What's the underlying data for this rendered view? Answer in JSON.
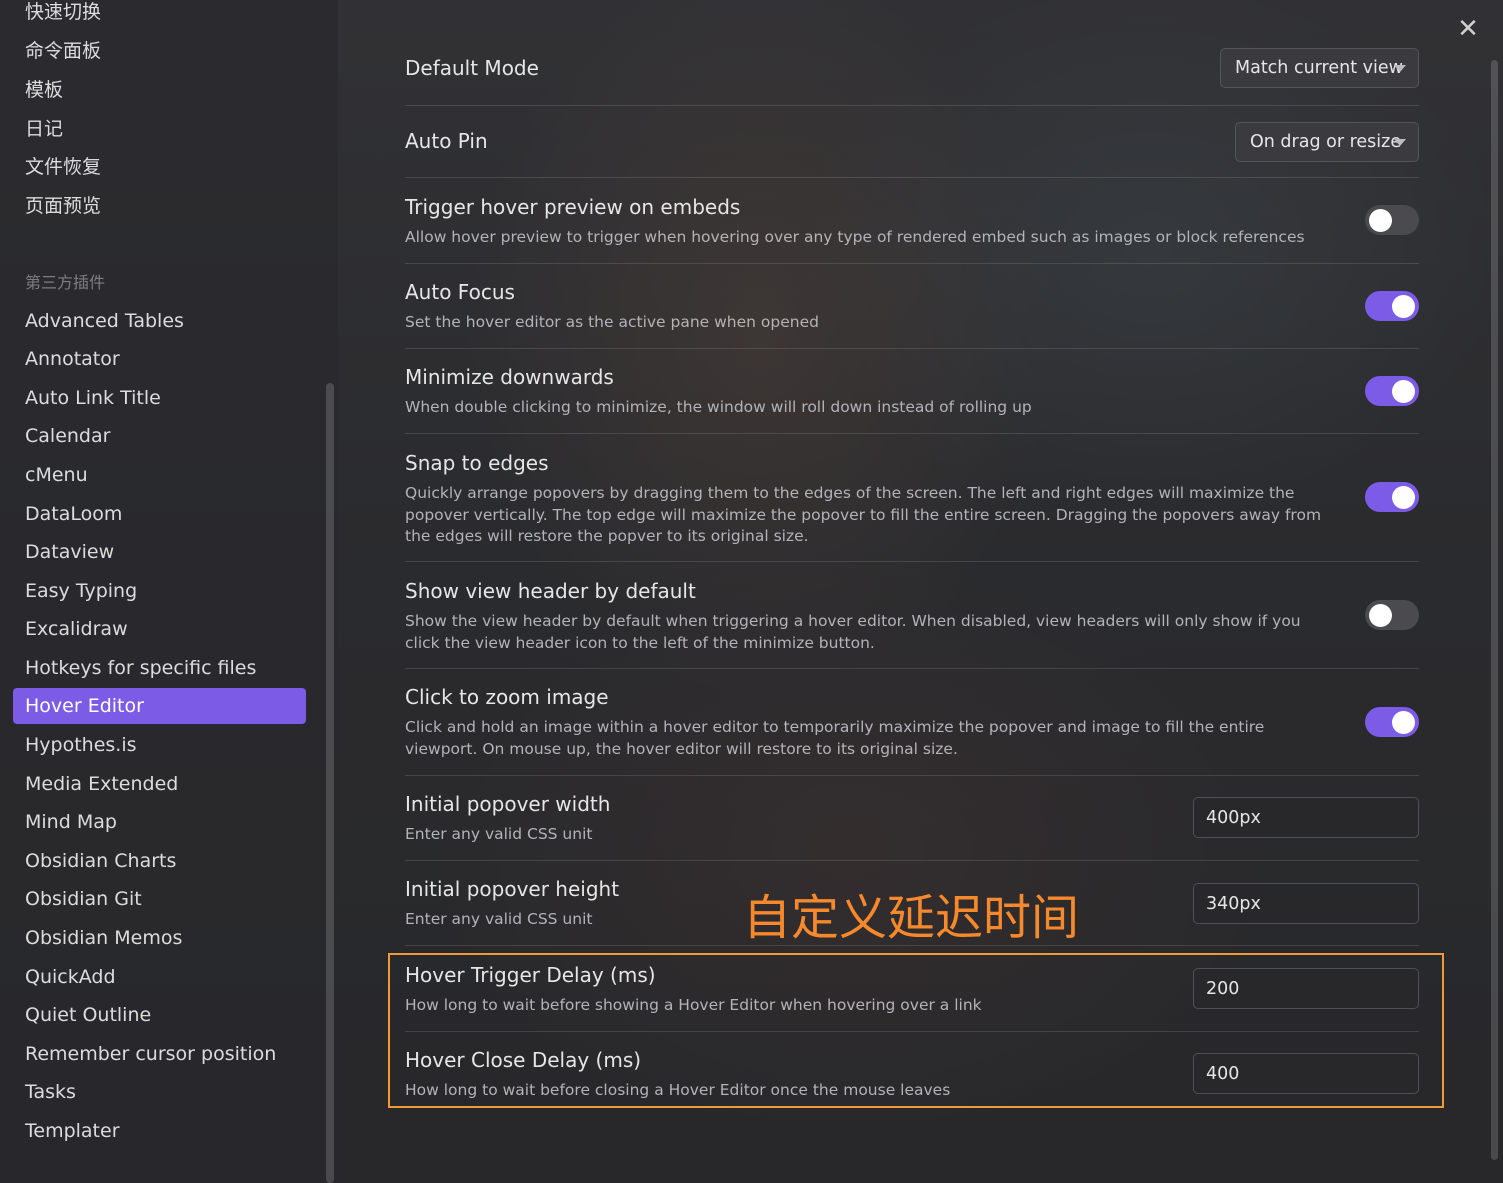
{
  "sidebar": {
    "core_items": [
      "快速切换",
      "命令面板",
      "模板",
      "日记",
      "文件恢复",
      "页面预览"
    ],
    "group_title": "第三方插件",
    "plugin_items": [
      "Advanced Tables",
      "Annotator",
      "Auto Link Title",
      "Calendar",
      "cMenu",
      "DataLoom",
      "Dataview",
      "Easy Typing",
      "Excalidraw",
      "Hotkeys for specific files",
      "Hover Editor",
      "Hypothes.is",
      "Media Extended",
      "Mind Map",
      "Obsidian Charts",
      "Obsidian Git",
      "Obsidian Memos",
      "QuickAdd",
      "Quiet Outline",
      "Remember cursor position",
      "Tasks",
      "Templater"
    ],
    "active_item": "Hover Editor"
  },
  "close_icon": "close-icon",
  "settings": {
    "default_mode": {
      "name": "Default Mode",
      "value": "Match current view"
    },
    "auto_pin": {
      "name": "Auto Pin",
      "value": "On drag or resize"
    },
    "trigger_embeds": {
      "name": "Trigger hover preview on embeds",
      "desc": "Allow hover preview to trigger when hovering over any type of rendered embed such as images or block references",
      "enabled": false
    },
    "auto_focus": {
      "name": "Auto Focus",
      "desc": "Set the hover editor as the active pane when opened",
      "enabled": true
    },
    "minimize_downwards": {
      "name": "Minimize downwards",
      "desc": "When double clicking to minimize, the window will roll down instead of rolling up",
      "enabled": true
    },
    "snap_edges": {
      "name": "Snap to edges",
      "desc": "Quickly arrange popovers by dragging them to the edges of the screen. The left and right edges will maximize the popover vertically. The top edge will maximize the popover to fill the entire screen. Dragging the popovers away from the edges will restore the popver to its original size.",
      "enabled": true
    },
    "view_header": {
      "name": "Show view header by default",
      "desc": "Show the view header by default when triggering a hover editor. When disabled, view headers will only show if you click the view header icon to the left of the minimize button.",
      "enabled": false
    },
    "click_zoom": {
      "name": "Click to zoom image",
      "desc": "Click and hold an image within a hover editor to temporarily maximize the popover and image to fill the entire viewport. On mouse up, the hover editor will restore to its original size.",
      "enabled": true
    },
    "popover_width": {
      "name": "Initial popover width",
      "desc": "Enter any valid CSS unit",
      "value": "400px"
    },
    "popover_height": {
      "name": "Initial popover height",
      "desc": "Enter any valid CSS unit",
      "value": "340px"
    },
    "trigger_delay": {
      "name": "Hover Trigger Delay (ms)",
      "desc": "How long to wait before showing a Hover Editor when hovering over a link",
      "value": "200"
    },
    "close_delay": {
      "name": "Hover Close Delay (ms)",
      "desc": "How long to wait before closing a Hover Editor once the mouse leaves",
      "value": "400"
    }
  },
  "annotation": {
    "text": "自定义延迟时间",
    "color": "#f5892b"
  },
  "colors": {
    "accent": "#7c5ce6",
    "highlight_border": "#f29a3a"
  }
}
